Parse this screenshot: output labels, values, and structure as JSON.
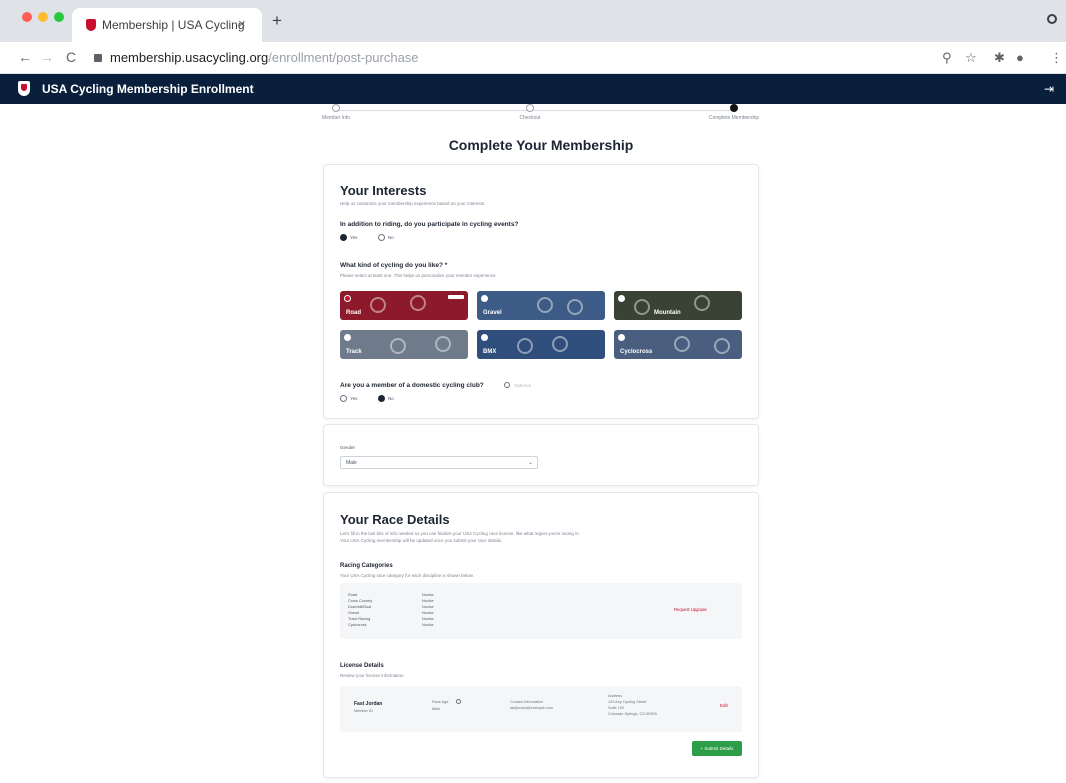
{
  "browser": {
    "tab_title": "Membership | USA Cycling",
    "tab_close": "×",
    "new_tab": "+",
    "url_host": "membership.usacycling.org",
    "url_path": "/enrollment/post-purchase",
    "nav": {
      "back": "←",
      "forward": "→",
      "reload": "C"
    },
    "toolbar_icons": [
      "zoom-icon",
      "star-icon",
      "extensions-icon",
      "profile-icon",
      "menu-icon"
    ]
  },
  "app": {
    "title": "USA Cycling Membership Enrollment",
    "logout_glyph": "⇥"
  },
  "stepper": {
    "steps": [
      {
        "label": "Member Info",
        "active": false
      },
      {
        "label": "Checkout",
        "active": false
      },
      {
        "label": "Complete Membership",
        "active": true
      }
    ]
  },
  "page": {
    "title": "Complete Your Membership"
  },
  "interests": {
    "heading": "Your Interests",
    "subtext": "Help us customize your membership experience based on your interests",
    "q_events": "In addition to riding, do you participate in cycling events?",
    "events_yes": "Yes",
    "events_no": "No",
    "events_selected": "Yes",
    "q_kind": "What kind of cycling do you like? *",
    "kind_help": "Please select at least one. This helps us personalize your member experience.",
    "tiles": [
      {
        "label": "Road",
        "selected": true,
        "badge": true,
        "color": "#8d1a2a"
      },
      {
        "label": "Gravel",
        "selected": false,
        "badge": false,
        "color": "#3c5b86"
      },
      {
        "label": "Mountain",
        "selected": false,
        "badge": false,
        "color": "#3a4135"
      },
      {
        "label": "Track",
        "selected": false,
        "badge": false,
        "color": "#6f7a8a"
      },
      {
        "label": "BMX",
        "selected": false,
        "badge": false,
        "color": "#2f4e7c"
      },
      {
        "label": "Cyclocross",
        "selected": false,
        "badge": false,
        "color": "#4a5f80"
      }
    ],
    "q_club": "Are you a member of a domestic cycling club?",
    "club_hint": "Optional",
    "club_yes": "Yes",
    "club_no": "No",
    "club_selected": "No"
  },
  "gender": {
    "label": "Gender",
    "value": "Male"
  },
  "race": {
    "heading": "Your Race Details",
    "intro_1": "Let's fill in the last bits of info needed so you can finalize your USA Cycling race license, like what region you're racing in.",
    "intro_2": "Your USA Cycling membership will be updated once you submit your race details.",
    "cat_heading": "Racing Categories",
    "cat_help": "Your USA Cycling race category for each discipline is shown below.",
    "categories": [
      {
        "name": "Road",
        "value": "Novice"
      },
      {
        "name": "Cross Country",
        "value": "Novice"
      },
      {
        "name": "Downhill/Dual",
        "value": "Novice"
      },
      {
        "name": "Gravel",
        "value": "Novice"
      },
      {
        "name": "Track Racing",
        "value": "Novice"
      },
      {
        "name": "Cyclocross",
        "value": "Novice"
      }
    ],
    "cat_link": "Request Upgrade",
    "lic_heading": "License Details",
    "lic_help": "Review your license information",
    "lic_name": "Fast Jordan",
    "lic_id": "Member ID",
    "lic_col2_top": "Race Age",
    "lic_col2_bottom": "Male",
    "lic_col3_top": "Contact Information",
    "lic_col3_bottom": "fastjordan@example.com",
    "lic_col4_top": "Address",
    "lic_col4_lines": [
      "123 Any Cycling Street",
      "Suite 100",
      "Colorado Springs, CO 80903"
    ],
    "lic_edit": "Edit",
    "submit": "+ Submit Details"
  }
}
